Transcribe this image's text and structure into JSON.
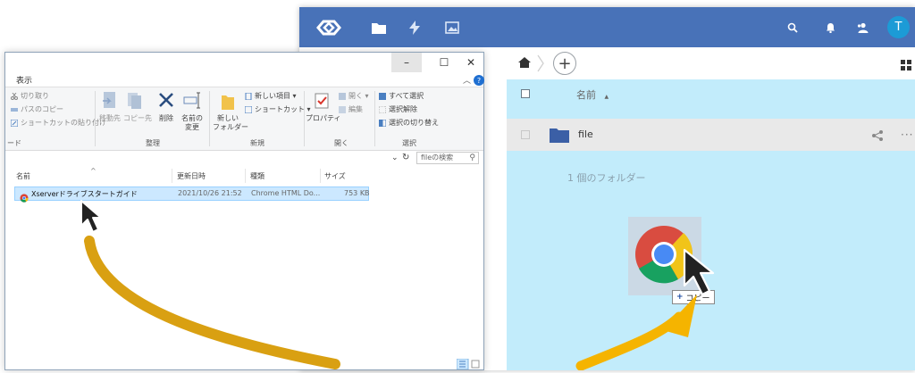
{
  "web": {
    "header": {
      "icons": [
        "app-logo-icon",
        "files-icon",
        "activity-icon",
        "gallery-icon",
        "search-icon",
        "bell-icon",
        "contacts-icon"
      ],
      "avatar_letter": "T",
      "color": "#4872b8"
    },
    "toolbar": {
      "add_label": "+"
    },
    "list": {
      "col_name": "名前",
      "sort_indicator": "▲",
      "rows": [
        {
          "name": "file",
          "more": "···"
        }
      ],
      "folder_count": "1 個のフォルダー"
    },
    "drop_area_color": "#c2ecfb",
    "drag": {
      "copy_plus": "+",
      "copy_label": "コピー"
    }
  },
  "explorer": {
    "window_buttons": {
      "minimize": "–",
      "maximize": "☐",
      "close": "✕"
    },
    "ribbon_tab": "表示",
    "ribbon_collapse": "︿",
    "help": "?",
    "ribbon": {
      "clipboard": {
        "cut": "切り取り",
        "copy_path": "パスのコピー",
        "paste_shortcut": "ショートカットの貼り付け",
        "group_edge": "ード"
      },
      "organize": {
        "move_to": "移動先",
        "copy_to": "コピー先",
        "delete": "削除",
        "rename_l1": "名前の",
        "rename_l2": "変更",
        "group": "整理"
      },
      "new": {
        "new_folder_l1": "新しい",
        "new_folder_l2": "フォルダー",
        "new_item": "新しい項目 ▾",
        "shortcut": "ショートカット ▾",
        "group": "新規"
      },
      "open": {
        "properties": "プロパティ",
        "open": "開く ▾",
        "edit": "編集",
        "group": "開く"
      },
      "select": {
        "select_all": "すべて選択",
        "select_none": "選択解除",
        "invert": "選択の切り替え",
        "group": "選択"
      }
    },
    "address": {
      "chevron": "⌄",
      "refresh": "↻",
      "search_placeholder": "fileの検索",
      "search_icon": "⚲"
    },
    "columns": {
      "name": "名前",
      "sort_caret": "^",
      "date": "更新日時",
      "type": "種類",
      "size": "サイズ"
    },
    "files": [
      {
        "name": "Xserverドライブスタートガイド",
        "date": "2021/10/26 21:52",
        "type": "Chrome HTML Do...",
        "size": "753 KB"
      }
    ]
  },
  "colors": {
    "arrow": "#d9a012",
    "arrow_right": "#f5b400",
    "selection": "#cce8ff"
  }
}
